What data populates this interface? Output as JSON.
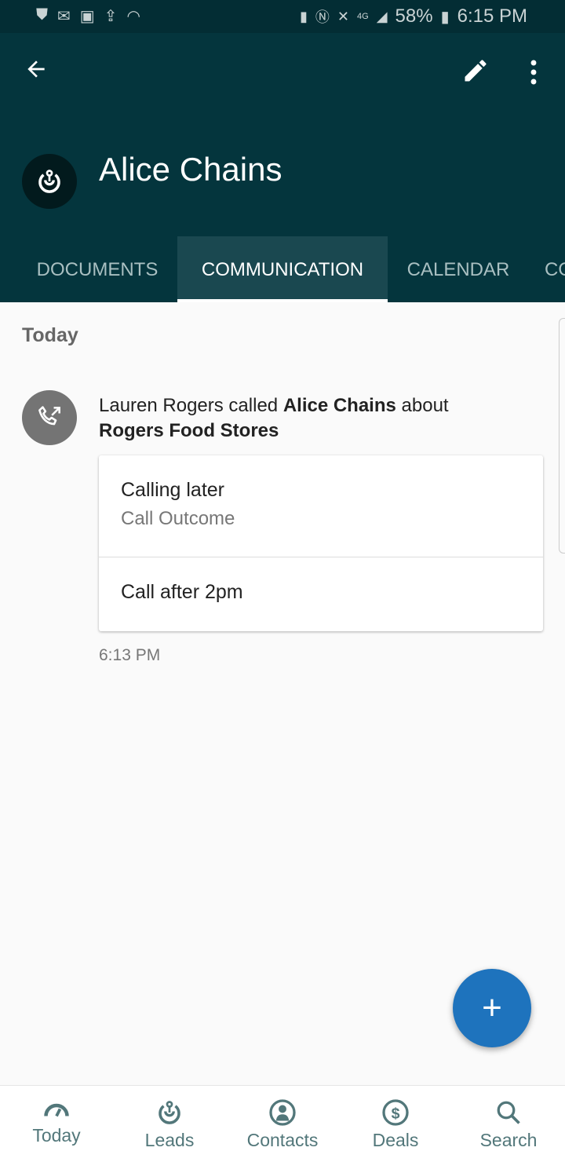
{
  "status_bar": {
    "left_icons": [
      "shield-icon",
      "gmail-icon",
      "image-icon",
      "upload-icon",
      "wifi-icon"
    ],
    "right_icons": [
      "battery-saver-icon",
      "nfc-icon",
      "mute-icon",
      "4g-lte-icon",
      "signal-icon"
    ],
    "battery": "58%",
    "time": "6:15 PM"
  },
  "header": {
    "title": "Alice Chains",
    "back_icon": "arrow-left-icon",
    "edit_icon": "pencil-icon",
    "more_icon": "more-vert-icon",
    "accent": "#04353d"
  },
  "tabs": [
    {
      "label": "DOCUMENTS"
    },
    {
      "label": "COMMUNICATION",
      "active": true
    },
    {
      "label": "CALENDAR"
    },
    {
      "label": "CO"
    }
  ],
  "content": {
    "section": "Today",
    "entry": {
      "actor": "Lauren Rogers",
      "verb_1": " called ",
      "target": "Alice Chains",
      "verb_2": " about ",
      "subject": "Rogers Food Stores",
      "fields": [
        {
          "value": "Calling later",
          "label": "Call Outcome"
        },
        {
          "value": "Call after 2pm"
        }
      ],
      "time": "6:13 PM"
    }
  },
  "fab": {
    "label": "+",
    "color": "#1e73bd"
  },
  "bottom_nav": [
    {
      "label": "Today",
      "icon": "speedometer-icon"
    },
    {
      "label": "Leads",
      "icon": "leads-icon"
    },
    {
      "label": "Contacts",
      "icon": "contact-icon"
    },
    {
      "label": "Deals",
      "icon": "dollar-icon"
    },
    {
      "label": "Search",
      "icon": "search-icon"
    }
  ]
}
